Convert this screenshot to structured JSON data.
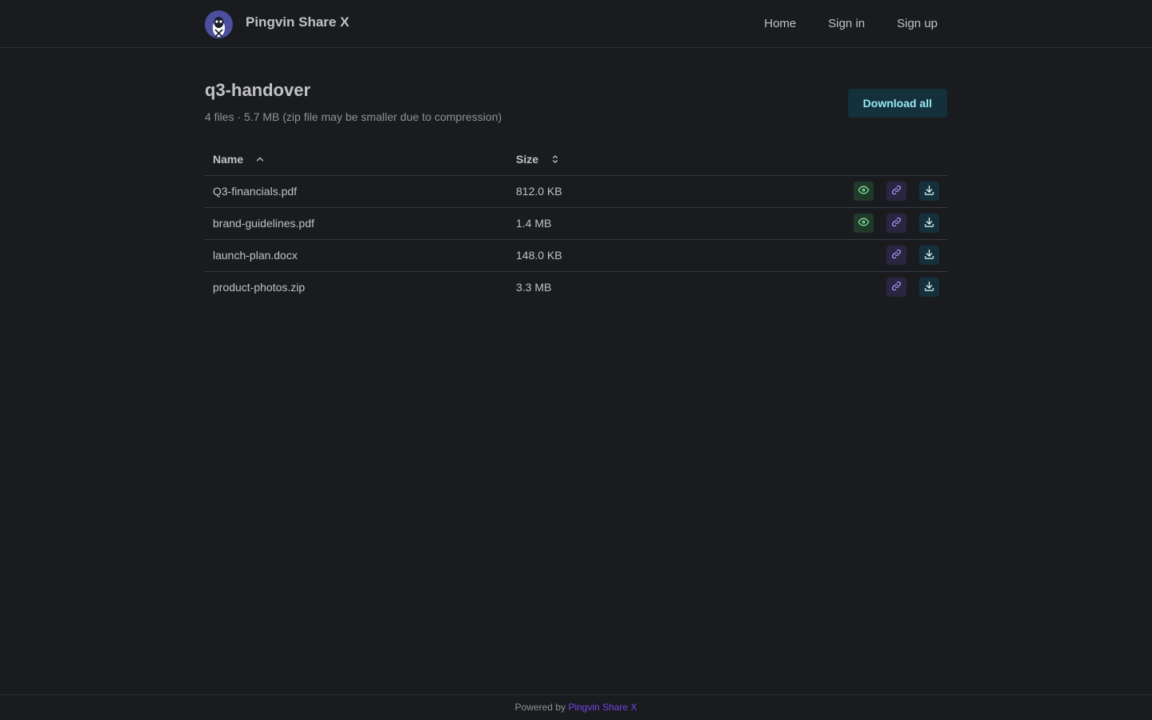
{
  "header": {
    "app_name": "Pingvin Share X",
    "nav": [
      {
        "label": "Home"
      },
      {
        "label": "Sign in"
      },
      {
        "label": "Sign up"
      }
    ]
  },
  "share": {
    "title": "q3-handover",
    "meta": "4 files · 5.7 MB (zip file may be smaller due to compression)",
    "download_all_label": "Download all"
  },
  "table": {
    "columns": {
      "name": "Name",
      "size": "Size"
    },
    "sort": {
      "column": "name",
      "direction": "asc"
    },
    "rows": [
      {
        "name": "Q3-financials.pdf",
        "size": "812.0 KB",
        "previewable": true
      },
      {
        "name": "brand-guidelines.pdf",
        "size": "1.4 MB",
        "previewable": true
      },
      {
        "name": "launch-plan.docx",
        "size": "148.0 KB",
        "previewable": false
      },
      {
        "name": "product-photos.zip",
        "size": "3.3 MB",
        "previewable": false
      }
    ]
  },
  "footer": {
    "prefix": "Powered by",
    "link_label": "Pingvin Share X"
  },
  "colors": {
    "background": "#1a1b1e",
    "accent_link": "#7048e8",
    "download_button_text": "#99e9f2",
    "preview_icon": "#8ce99a",
    "link_icon": "#b197fc"
  },
  "icons": {
    "preview": "eye-icon",
    "copy_link": "link-icon",
    "download": "download-icon",
    "sort_name": "chevron-up-icon",
    "sort_size": "selector-icon"
  }
}
